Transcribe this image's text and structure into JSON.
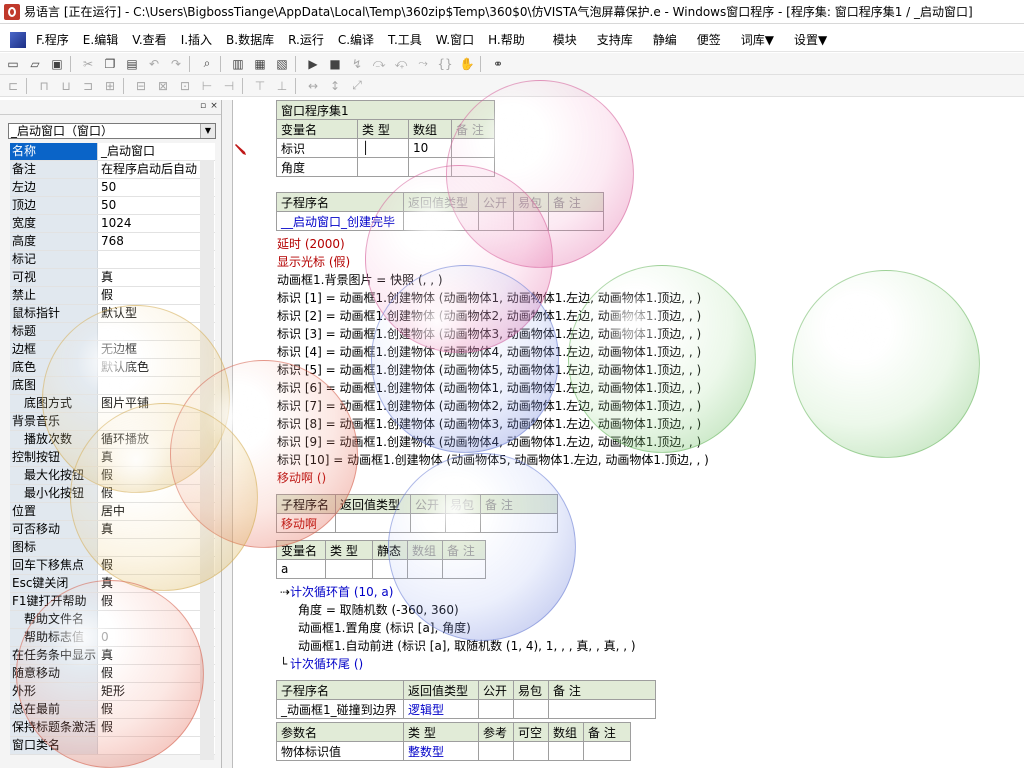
{
  "window": {
    "title": "易语言 [正在运行] - C:\\Users\\BigbossTiange\\AppData\\Local\\Temp\\360zip$Temp\\360$0\\仿VISTA气泡屏幕保护.e - Windows窗口程序 - [程序集: 窗口程序集1 / _启动窗口]"
  },
  "menu": [
    "F.程序",
    "E.编辑",
    "V.查看",
    "I.插入",
    "B.数据库",
    "R.运行",
    "C.编译",
    "T.工具",
    "W.窗口",
    "H.帮助",
    "模块",
    "支持库",
    "静编",
    "便签",
    "词库▼",
    "设置▼"
  ],
  "property_panel": {
    "combo": "_启动窗口（窗口）",
    "rows": [
      {
        "name": "名称",
        "value": "_启动窗口",
        "selected": true
      },
      {
        "name": "备注",
        "value": "在程序启动后自动"
      },
      {
        "name": "左边",
        "value": "50"
      },
      {
        "name": "顶边",
        "value": "50"
      },
      {
        "name": "宽度",
        "value": "1024"
      },
      {
        "name": "高度",
        "value": "768"
      },
      {
        "name": "标记",
        "value": ""
      },
      {
        "name": "可视",
        "value": "真"
      },
      {
        "name": "禁止",
        "value": "假"
      },
      {
        "name": "鼠标指针",
        "value": "默认型"
      },
      {
        "name": "标题",
        "value": ""
      },
      {
        "name": "边框",
        "value": "无边框"
      },
      {
        "name": "底色",
        "value": "默认底色"
      },
      {
        "name": "底图",
        "value": ""
      },
      {
        "name": "底图方式",
        "value": "图片平铺",
        "sub": true
      },
      {
        "name": "背景音乐",
        "value": ""
      },
      {
        "name": "播放次数",
        "value": "循环播放",
        "sub": true
      },
      {
        "name": "控制按钮",
        "value": "真"
      },
      {
        "name": "最大化按钮",
        "value": "假",
        "sub": true
      },
      {
        "name": "最小化按钮",
        "value": "假",
        "sub": true
      },
      {
        "name": "位置",
        "value": "居中"
      },
      {
        "name": "可否移动",
        "value": "真"
      },
      {
        "name": "图标",
        "value": ""
      },
      {
        "name": "回车下移焦点",
        "value": "假"
      },
      {
        "name": "Esc键关闭",
        "value": "真"
      },
      {
        "name": "F1键打开帮助",
        "value": "假"
      },
      {
        "name": "帮助文件名",
        "value": "",
        "sub": true
      },
      {
        "name": "帮助标志值",
        "value": "0",
        "sub": true,
        "dim": true
      },
      {
        "name": "在任务条中显示",
        "value": "真"
      },
      {
        "name": "随意移动",
        "value": "假"
      },
      {
        "name": "外形",
        "value": "矩形"
      },
      {
        "name": "总在最前",
        "value": "假"
      },
      {
        "name": "保持标题条激活",
        "value": "假"
      },
      {
        "name": "窗口类名",
        "value": ""
      }
    ]
  },
  "editor": {
    "assembly": {
      "name": "窗口程序集1",
      "headers": [
        "变量名",
        "类 型",
        "数组",
        "备 注"
      ],
      "rows": [
        [
          "标识",
          "",
          "10",
          ""
        ],
        [
          "角度",
          "",
          "",
          ""
        ]
      ]
    },
    "sub1": {
      "headers": [
        "子程序名",
        "返回值类型",
        "公开",
        "易包",
        "备 注"
      ],
      "name": "__启动窗口_创建完毕"
    },
    "code1": [
      "延时 (2000)",
      "显示光标 (假)",
      "动画框1.背景图片 = 快照 (, , )",
      "标识 [1] = 动画框1.创建物体 (动画物体1, 动画物体1.左边, 动画物体1.顶边, , )",
      "标识 [2] = 动画框1.创建物体 (动画物体2, 动画物体1.左边, 动画物体1.顶边, , )",
      "标识 [3] = 动画框1.创建物体 (动画物体3, 动画物体1.左边, 动画物体1.顶边, , )",
      "标识 [4] = 动画框1.创建物体 (动画物体4, 动画物体1.左边, 动画物体1.顶边, , )",
      "标识 [5] = 动画框1.创建物体 (动画物体5, 动画物体1.左边, 动画物体1.顶边, , )",
      "标识 [6] = 动画框1.创建物体 (动画物体1, 动画物体1.左边, 动画物体1.顶边, , )",
      "标识 [7] = 动画框1.创建物体 (动画物体2, 动画物体1.左边, 动画物体1.顶边, , )",
      "标识 [8] = 动画框1.创建物体 (动画物体3, 动画物体1.左边, 动画物体1.顶边, , )",
      "标识 [9] = 动画框1.创建物体 (动画物体4, 动画物体1.左边, 动画物体1.顶边, , )",
      "标识 [10] = 动画框1.创建物体 (动画物体5, 动画物体1.左边, 动画物体1.顶边, , )",
      "移动啊 ()"
    ],
    "sub2": {
      "headers": [
        "子程序名",
        "返回值类型",
        "公开",
        "易包",
        "备 注"
      ],
      "name": "移动啊",
      "var_headers": [
        "变量名",
        "类 型",
        "静态",
        "数组",
        "备 注"
      ],
      "var_rows": [
        [
          "a",
          "",
          "",
          "",
          ""
        ]
      ]
    },
    "code2": [
      "计次循环首 (10, a)",
      "角度 = 取随机数 (-360, 360)",
      "动画框1.置角度 (标识 [a], 角度)",
      "动画框1.自动前进 (标识 [a], 取随机数 (1, 4), 1, , , 真, , 真, , )",
      "计次循环尾 ()"
    ],
    "sub3": {
      "headers": [
        "子程序名",
        "返回值类型",
        "公开",
        "易包",
        "备 注"
      ],
      "name": "_动画框1_碰撞到边界",
      "return_type": "逻辑型",
      "param_headers": [
        "参数名",
        "类 型",
        "参考",
        "可空",
        "数组",
        "备 注"
      ],
      "param_rows": [
        [
          "物体标识值",
          "整数型",
          "",
          "",
          "",
          ""
        ]
      ]
    }
  },
  "bubbles": [
    {
      "color": "pink"
    },
    {
      "color": "pink"
    },
    {
      "color": "blue"
    },
    {
      "color": "green"
    },
    {
      "color": "green"
    },
    {
      "color": "yellow"
    },
    {
      "color": "red"
    },
    {
      "color": "yellow"
    },
    {
      "color": "blue"
    },
    {
      "color": "red"
    }
  ]
}
